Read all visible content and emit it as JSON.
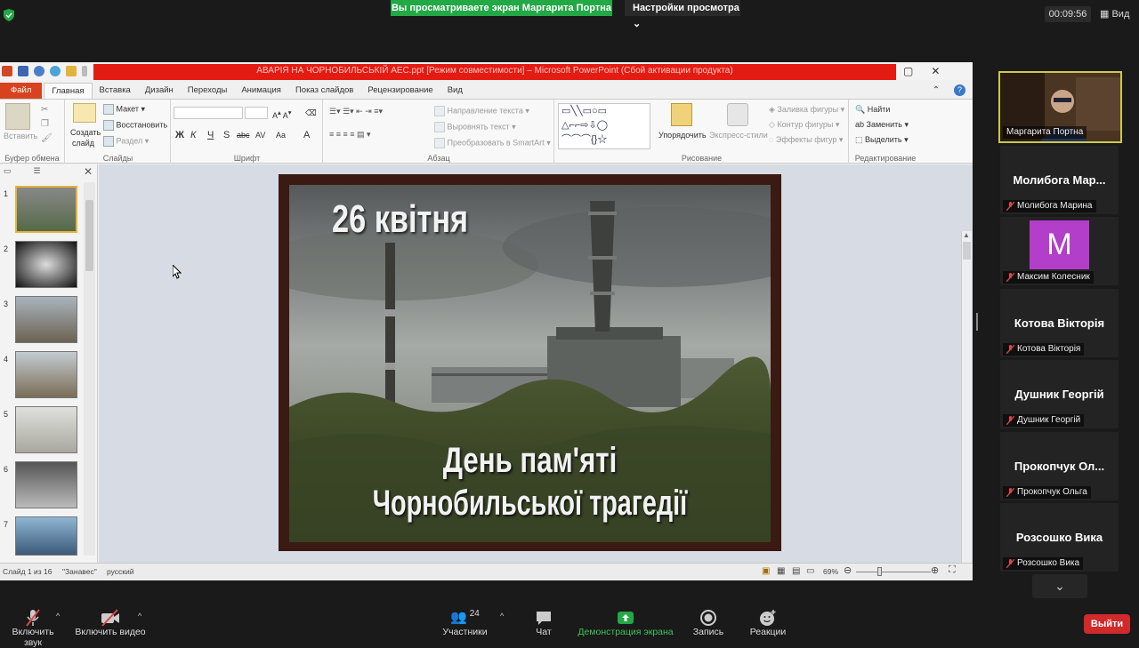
{
  "top_bar": {
    "share_banner": "Вы просматриваете экран Маргарита Портна",
    "view_options": "Настройки просмотра",
    "timer": "00:09:56",
    "view_label": "Вид"
  },
  "ppt": {
    "title": "АВАРІЯ НА ЧОРНОБИЛЬСЬКІЙ АЕС.ppt [Режим совместимости] – Microsoft PowerPoint (Сбой активации продукта)",
    "tabs": [
      "Файл",
      "Главная",
      "Вставка",
      "Дизайн",
      "Переходы",
      "Анимация",
      "Показ слайдов",
      "Рецензирование",
      "Вид"
    ],
    "ribbon": {
      "clipboard": {
        "paste": "Вставить",
        "label": "Буфер обмена"
      },
      "slides": {
        "create_1": "Создать",
        "create_2": "слайд",
        "layout": "Макет",
        "reset": "Восстановить",
        "section": "Раздел",
        "label": "Слайды"
      },
      "font": {
        "bold": "Ж",
        "italic": "К",
        "underline": "Ч",
        "shadow": "S",
        "strike": "abc",
        "spacing": "AV",
        "case": "Aa",
        "label": "Шрифт"
      },
      "paragraph": {
        "direction": "Направление текста",
        "align": "Выровнять текст",
        "smartart": "Преобразовать в SmartArt",
        "label": "Абзац"
      },
      "drawing": {
        "arrange": "Упорядочить",
        "quick_styles": "Экспресс-стили",
        "fill": "Заливка фигуры",
        "outline": "Контур фигуры",
        "effects": "Эффекты фигур",
        "label": "Рисование"
      },
      "editing": {
        "find": "Найти",
        "replace": "Заменить",
        "select": "Выделить",
        "label": "Редактирование"
      }
    },
    "slide_numbers": [
      "1",
      "2",
      "3",
      "4",
      "5",
      "6",
      "7"
    ],
    "slide": {
      "date_text": "26 квітня",
      "line1": "День пам'яті",
      "line2": "Чорнобильської трагедії"
    },
    "status": {
      "slide_of": "Слайд 1 из 16",
      "theme": "\"Занавес\"",
      "language": "русский",
      "zoom": "69%"
    }
  },
  "participants": [
    {
      "display": "",
      "label": "Маргарита Портна",
      "video": true
    },
    {
      "display": "Молибога Мар...",
      "label": "Молибога Марина"
    },
    {
      "display": "M",
      "label": "Максим Колесник",
      "avatar_color": "#b23ec9"
    },
    {
      "display": "Котова Вікторія",
      "label": "Котова Вікторія"
    },
    {
      "display": "Душник Георгій",
      "label": "Душник Георгій"
    },
    {
      "display": "Прокопчук Ол...",
      "label": "Прокопчук Ольга"
    },
    {
      "display": "Розсошко Вика",
      "label": "Розсошко Вика"
    }
  ],
  "toolbar": {
    "mute": "Включить звук",
    "video": "Включить видео",
    "participants": "Участники",
    "participants_count": "24",
    "chat": "Чат",
    "share": "Демонстрация экрана",
    "record": "Запись",
    "reactions": "Реакции",
    "leave": "Выйти"
  },
  "colors": {
    "share_green": "#23a846",
    "leave_red": "#d02a2a",
    "title_red": "#e41b12",
    "file_tab": "#d8431f",
    "active_border": "#c9c94a"
  }
}
